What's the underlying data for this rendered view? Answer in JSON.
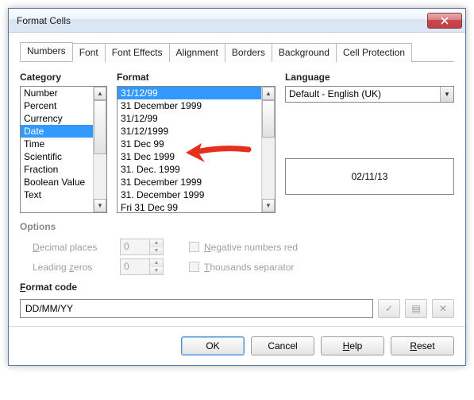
{
  "title": "Format Cells",
  "tabs": [
    {
      "label": "Numbers",
      "active": true
    },
    {
      "label": "Font"
    },
    {
      "label": "Font Effects"
    },
    {
      "label": "Alignment"
    },
    {
      "label": "Borders"
    },
    {
      "label": "Background"
    },
    {
      "label": "Cell Protection"
    }
  ],
  "labels": {
    "category": "Category",
    "format": "Format",
    "language": "Language",
    "options": "Options",
    "decimal_u": "D",
    "decimal_rest": "ecimal places",
    "leading_u": "z",
    "leading_pre": "Leading ",
    "leading_post": "eros",
    "neg_u": "N",
    "neg_rest": "egative numbers red",
    "th_u": "T",
    "th_rest": "housands separator",
    "format_code_u": "F",
    "format_code_rest": "ormat code"
  },
  "category_items": [
    "Number",
    "Percent",
    "Currency",
    "Date",
    "Time",
    "Scientific",
    "Fraction",
    "Boolean Value",
    "Text"
  ],
  "category_selected": 3,
  "format_items": [
    "31/12/99",
    "31 December 1999",
    "31/12/99",
    "31/12/1999",
    "31 Dec 99",
    "31 Dec 1999",
    "31. Dec. 1999",
    "31 December 1999",
    "31. December 1999",
    "Fri 31 Dec 99"
  ],
  "format_selected": 0,
  "language_value": "Default - English (UK)",
  "preview_value": "02/11/13",
  "decimal_value": "0",
  "leading_value": "0",
  "format_code": "DD/MM/YY",
  "buttons": {
    "ok": "OK",
    "cancel": "Cancel",
    "help_u": "H",
    "help_rest": "elp",
    "reset_u": "R",
    "reset_rest": "eset"
  },
  "icons": {
    "check": "✓",
    "note": "▤",
    "x": "✕"
  }
}
